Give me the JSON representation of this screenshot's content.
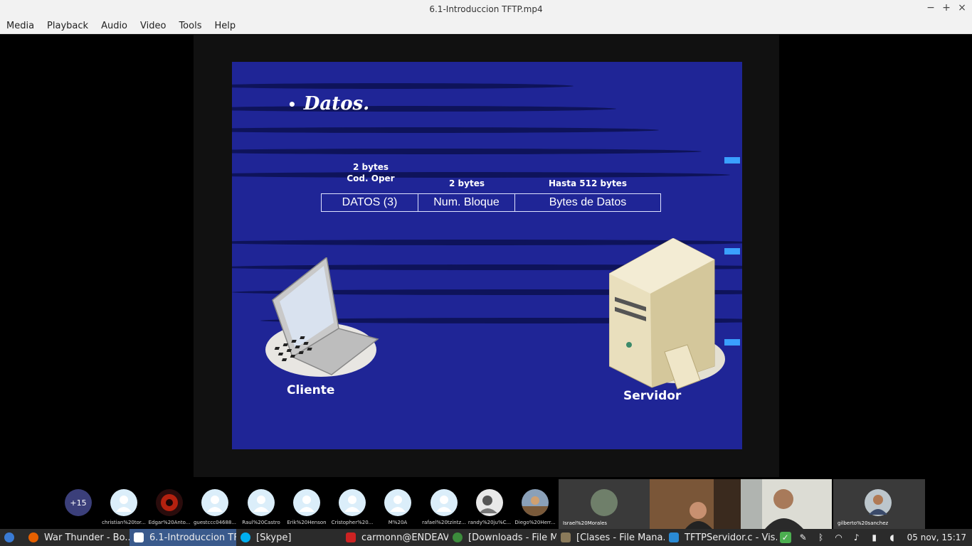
{
  "window": {
    "title": "6.1-Introduccion TFTP.mp4"
  },
  "menu": [
    "Media",
    "Playback",
    "Audio",
    "Video",
    "Tools",
    "Help"
  ],
  "slide": {
    "bullet": "•",
    "title": "Datos.",
    "fields": [
      {
        "header_line1": "2 bytes",
        "header_line2": "Cod. Oper",
        "cell": "DATOS (3)"
      },
      {
        "header_line1": "2 bytes",
        "header_line2": "",
        "cell": "Num. Bloque"
      },
      {
        "header_line1": "Hasta 512 bytes",
        "header_line2": "",
        "cell": "Bytes de Datos"
      }
    ],
    "client_label": "Cliente",
    "server_label": "Servidor"
  },
  "meeting": {
    "overflow_count": "+15",
    "participants": [
      {
        "name": "christian%20tor..."
      },
      {
        "name": "Edgar%20Anto..."
      },
      {
        "name": "guestccc04688..."
      },
      {
        "name": "Raul%20Castro"
      },
      {
        "name": "Erik%20Henson"
      },
      {
        "name": "Cristopher%20..."
      },
      {
        "name": "M%20A"
      },
      {
        "name": "rafael%20tzintz..."
      },
      {
        "name": "randy%20ju%C..."
      },
      {
        "name": "Diego%20Herr..."
      }
    ],
    "video_tiles": [
      {
        "name": "Israel%20Morales"
      },
      {
        "name": ""
      },
      {
        "name": ""
      },
      {
        "name": "gilberto%20sanchez"
      }
    ]
  },
  "taskbar": {
    "tasks": [
      {
        "label": "War Thunder - Bo...",
        "active": false,
        "color": "#e66000"
      },
      {
        "label": "6.1-Introduccion TF...",
        "active": true,
        "color": "#ffffff"
      },
      {
        "label": "[Skype]",
        "active": false,
        "color": "#00aff0"
      },
      {
        "label": "carmonn@ENDEAV...",
        "active": false,
        "color": "#cc2222"
      },
      {
        "label": "[Downloads - File M...",
        "active": false,
        "color": "#3c8c3c"
      },
      {
        "label": "[Clases - File Mana...",
        "active": false,
        "color": "#8a7a5a"
      },
      {
        "label": "TFTPServidor.c - Vis...",
        "active": false,
        "color": "#2a8ad4"
      }
    ],
    "clock": "05 nov, 15:17"
  }
}
